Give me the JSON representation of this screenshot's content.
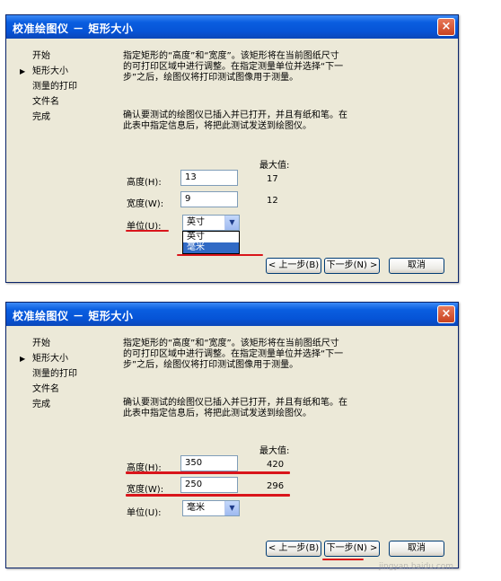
{
  "dialog1": {
    "title": "校准绘图仪 － 矩形大小",
    "close_label": "×",
    "nav": [
      "开始",
      "矩形大小",
      "测量的打印",
      "文件名",
      "完成"
    ],
    "desc1": "指定矩形的“高度”和“宽度”。该矩形将在当前图纸尺寸的可打印区域中进行调整。在指定测量单位并选择“下一步”之后，绘图仪将打印测试图像用于测量。",
    "desc2": "确认要测试的绘图仪已插入并已打开，并且有纸和笔。在此表中指定信息后，将把此测试发送到绘图仪。",
    "max_label": "最大值:",
    "height_label": "高度(H):",
    "width_label": "宽度(W):",
    "unit_label": "单位(U):",
    "height_value": "13",
    "width_value": "9",
    "height_max": "17",
    "width_max": "12",
    "unit_value": "英寸",
    "unit_options": [
      "英寸",
      "毫米"
    ],
    "back_label": "< 上一步(B)",
    "next_label": "下一步(N) >",
    "cancel_label": "取消"
  },
  "dialog2": {
    "title": "校准绘图仪 － 矩形大小",
    "close_label": "×",
    "nav": [
      "开始",
      "矩形大小",
      "测量的打印",
      "文件名",
      "完成"
    ],
    "desc1": "指定矩形的“高度”和“宽度”。该矩形将在当前图纸尺寸的可打印区域中进行调整。在指定测量单位并选择“下一步”之后，绘图仪将打印测试图像用于测量。",
    "desc2": "确认要测试的绘图仪已插入并已打开，并且有纸和笔。在此表中指定信息后，将把此测试发送到绘图仪。",
    "max_label": "最大值:",
    "height_label": "高度(H):",
    "width_label": "宽度(W):",
    "unit_label": "单位(U):",
    "height_value": "350",
    "width_value": "250",
    "height_max": "420",
    "width_max": "296",
    "unit_value": "毫米",
    "back_label": "< 上一步(B)",
    "next_label": "下一步(N) >",
    "cancel_label": "取消"
  },
  "watermark": "jingyan.baidu.com",
  "colors": {
    "title_blue": "#0653d6",
    "dialog_bg": "#ece9d8",
    "annotation_red": "#d9151b"
  }
}
